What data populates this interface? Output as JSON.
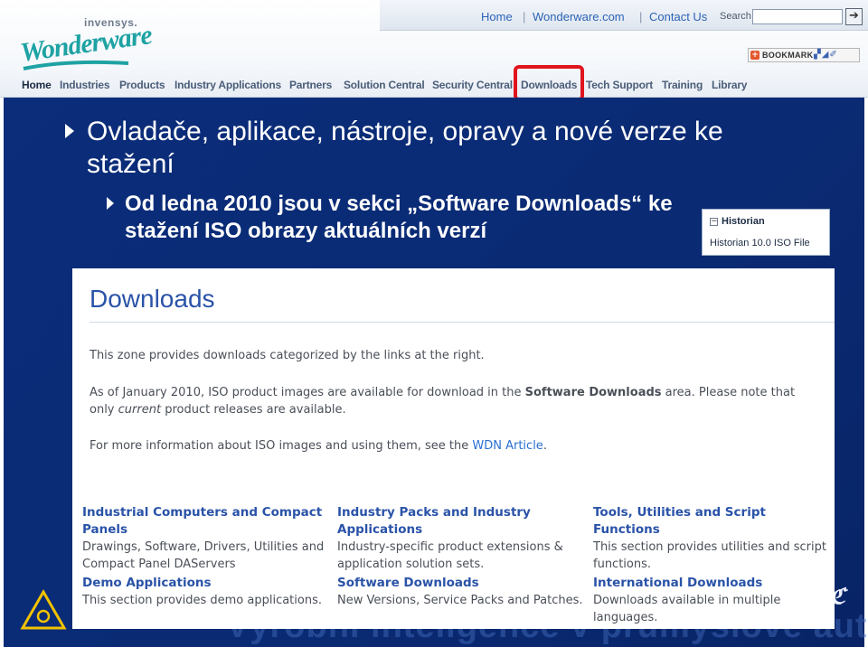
{
  "site": {
    "logo_company": "invensys.",
    "logo_brand": "Wonderware",
    "top_links": [
      "Home",
      "Wonderware.com",
      "Contact Us"
    ],
    "search_label": "Search",
    "search_value": "",
    "bookmark_label": "BOOKMARK",
    "nav": [
      "Home",
      "Industries",
      "Products",
      "Industry Applications",
      "Partners",
      "Solution Central",
      "Security Central",
      "Downloads",
      "Tech Support",
      "Training",
      "Library"
    ]
  },
  "slide": {
    "heading": "Ovladače, aplikace, nástroje, opravy a nové verze ke stažení",
    "subpoint": "Od ledna 2010 jsou v sekci „Software Downloads“ ke stažení ISO obrazy aktuálních verzí",
    "historian_title": "Historian",
    "historian_file": "Historian 10.0 ISO File",
    "footer_text": "Výrobní inteligence v průmyslové automatizaci"
  },
  "downloads": {
    "title": "Downloads",
    "intro": "This zone provides downloads categorized by the links at the right.",
    "iso_p1_a": "As of January 2010, ISO product images are available for download in the ",
    "iso_p1_b": "Software Downloads",
    "iso_p1_c": " area. Please note that",
    "iso_p2_a": "only ",
    "iso_p2_b": "current",
    "iso_p2_c": " product releases are available.",
    "more_a": "For more information about ISO images and using them, see the ",
    "more_link": "WDN Article",
    "more_c": ".",
    "categories": [
      {
        "title": "Industrial Computers and Compact Panels",
        "desc": "Drawings, Software, Drivers, Utilities and Compact Panel DAServers"
      },
      {
        "title": "Industry Packs and Industry Applications",
        "desc": "Industry-specific product extensions & application solution sets."
      },
      {
        "title": "Tools, Utilities and Script Functions",
        "desc": "This section provides utilities and script functions."
      },
      {
        "title": "Demo Applications",
        "desc": "This section provides demo applications."
      },
      {
        "title": "Software Downloads",
        "desc": "New Versions, Service Packs and Patches."
      },
      {
        "title": "International Downloads",
        "desc": "Downloads available in multiple languages."
      }
    ]
  },
  "colors": {
    "slide_blue": "#0b2d7a",
    "link_blue": "#2a53a8",
    "highlight_red": "#e0141d",
    "brand_teal": "#1ea2a3"
  }
}
